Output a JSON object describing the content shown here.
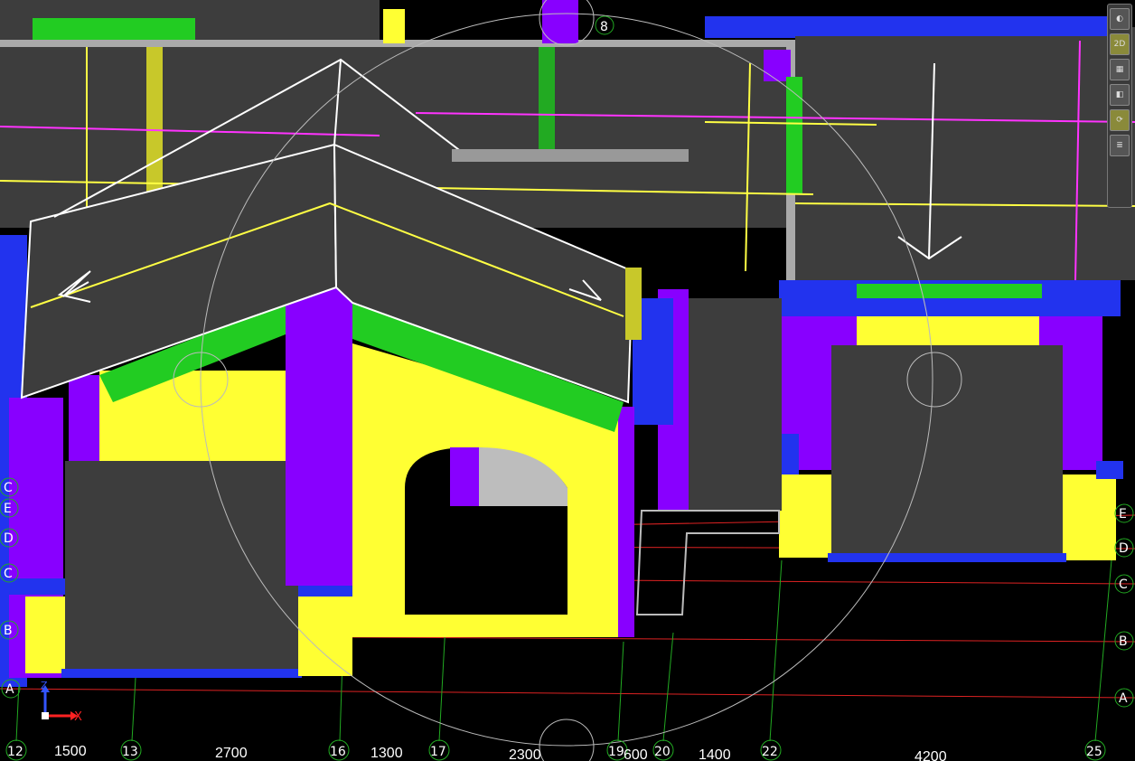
{
  "grid_axes": {
    "columns": [
      "12",
      "13",
      "16",
      "17",
      "19",
      "20",
      "22",
      "25"
    ],
    "column_spacings": [
      "1500",
      "2700",
      "1300",
      "2300",
      "600",
      "1400",
      "4200"
    ],
    "rows_left": [
      "C",
      "E",
      "D",
      "C",
      "B",
      "A"
    ],
    "rows_right": [
      "E",
      "D",
      "C",
      "B",
      "A"
    ],
    "top_marker": "8"
  },
  "ucs": {
    "x_label": "X",
    "z_label": "Z"
  },
  "toolbar": {
    "buttons": [
      {
        "name": "orbit",
        "glyph": "◐"
      },
      {
        "name": "view-2d",
        "glyph": "2D"
      },
      {
        "name": "view-3d",
        "glyph": "▦"
      },
      {
        "name": "view-front",
        "glyph": "◧"
      },
      {
        "name": "rotate",
        "glyph": "⟳"
      },
      {
        "name": "layers",
        "glyph": "≣"
      }
    ]
  },
  "colors": {
    "background": "#000000",
    "roof": "#3d3d3d",
    "wall_yellow": "#ffff33",
    "column_purple": "#8800ff",
    "beam_green": "#22cc22",
    "slab_blue": "#2233ee",
    "grid_red": "#dd2222",
    "grid_green": "#22aa22",
    "line_magenta": "#ff33ff",
    "line_yellow": "#ffff44"
  }
}
